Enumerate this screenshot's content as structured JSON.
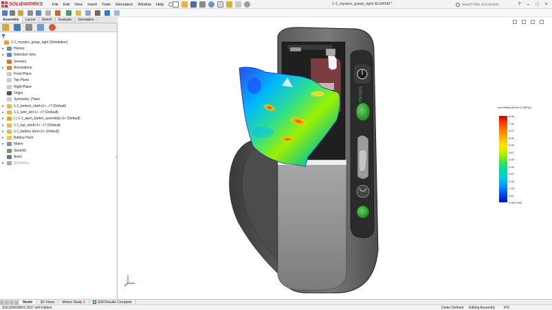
{
  "app": {
    "logo_text": "SOLIDWORKS",
    "document_title": "1-1_myopro_grasp_right.SLDASM *",
    "search_placeholder": "Search files and models"
  },
  "menu": [
    "File",
    "Edit",
    "View",
    "Insert",
    "Tools",
    "Simulation",
    "Window",
    "Help"
  ],
  "command_tabs": [
    "Assembly",
    "Layout",
    "Sketch",
    "Evaluate",
    "Simulation"
  ],
  "active_command_tab": "Assembly",
  "feature_tree": [
    {
      "label": "1-1_myopro_grasp_right  (Simulation)",
      "icon": "assembly-icon",
      "arrow": "",
      "indent": 0
    },
    {
      "label": "History",
      "icon": "history-icon",
      "arrow": "▸",
      "indent": 1
    },
    {
      "label": "Selection Sets",
      "icon": "selection-sets-icon",
      "arrow": "▸",
      "indent": 1
    },
    {
      "label": "Sensors",
      "icon": "sensors-icon",
      "arrow": "",
      "indent": 1
    },
    {
      "label": "Annotations",
      "icon": "annotations-icon",
      "arrow": "▸",
      "indent": 1
    },
    {
      "label": "Front Plane",
      "icon": "plane-icon",
      "arrow": "",
      "indent": 1
    },
    {
      "label": "Top Plane",
      "icon": "plane-icon",
      "arrow": "",
      "indent": 1
    },
    {
      "label": "Right Plane",
      "icon": "plane-icon",
      "arrow": "",
      "indent": 1
    },
    {
      "label": "Origin",
      "icon": "origin-icon",
      "arrow": "",
      "indent": 1
    },
    {
      "label": "Symmetry_Plane",
      "icon": "plane-icon",
      "arrow": "",
      "indent": 1
    },
    {
      "label": "1-1_bottom_shell<1> ->? (Default)",
      "icon": "part-icon",
      "arrow": "▸",
      "indent": 1
    },
    {
      "label": "1-1_wire_lid<1> ->? (Default)",
      "icon": "part-icon",
      "arrow": "▸",
      "indent": 1
    },
    {
      "label": "(-) 1-1_eject_button_assembly<1> (Default)",
      "icon": "subassembly-icon",
      "arrow": "▸",
      "indent": 1
    },
    {
      "label": "1-1_top_shell<1> ->? (Default)",
      "icon": "part-icon",
      "arrow": "▸",
      "indent": 1
    },
    {
      "label": "1-1_battery door<1> (Default)",
      "icon": "part-icon",
      "arrow": "▸",
      "indent": 1
    },
    {
      "label": "Battery Pack",
      "icon": "folder-icon",
      "arrow": "▸",
      "indent": 1
    },
    {
      "label": "Mates",
      "icon": "mates-icon",
      "arrow": "▸",
      "indent": 1
    },
    {
      "label": "Sketch5",
      "icon": "sketch-icon",
      "arrow": "",
      "indent": 1
    },
    {
      "label": "Axis1",
      "icon": "axis-icon",
      "arrow": "",
      "indent": 1
    },
    {
      "label": "Symmetry",
      "icon": "pattern-icon",
      "arrow": "▸",
      "indent": 1,
      "muted": true
    }
  ],
  "legend": {
    "title": "von Mises (N/mm^2 (MPa))",
    "values": [
      "8.00",
      "7.33",
      "6.67",
      "6.00",
      "5.33",
      "4.67",
      "4.00",
      "3.33",
      "2.67",
      "2.00",
      "1.33",
      "0.67",
      "0.00e+000"
    ]
  },
  "device_label": "myopro",
  "model_tabs": [
    "Model",
    "3D Views",
    "Motion Study 1",
    "SIM Results Complete"
  ],
  "active_model_tab": "Model",
  "status": {
    "edition": "SOLIDWORKS 2017 x64 Edition",
    "state": "Under Defined",
    "mode": "Editing Assembly",
    "units": "IPS"
  },
  "colors": {
    "brand_red": "#c8262b",
    "accent_blue": "#1f63b5",
    "device_green": "#2e9e3a"
  }
}
